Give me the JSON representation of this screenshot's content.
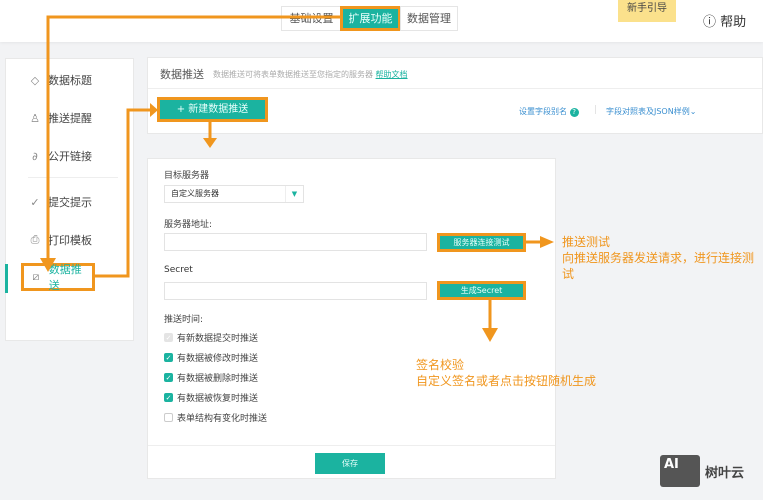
{
  "header": {
    "tabs": [
      {
        "label": "基础设置"
      },
      {
        "label": "扩展功能",
        "active": true
      },
      {
        "label": "数据管理"
      }
    ],
    "guide": "新手引导",
    "help": "帮助"
  },
  "sidebar": {
    "items": [
      {
        "label": "数据标题",
        "icon": "tag-icon"
      },
      {
        "label": "推送提醒",
        "icon": "bell-icon"
      },
      {
        "label": "公开链接",
        "icon": "link-icon"
      },
      {
        "label": "提交提示",
        "icon": "check-circle-icon"
      },
      {
        "label": "打印模板",
        "icon": "printer-icon"
      },
      {
        "label": "数据推送",
        "icon": "chart-icon",
        "active": true
      }
    ]
  },
  "panel": {
    "title": "数据推送",
    "desc": "数据推送可将表单数据推送至您指定的服务器",
    "help_link": "帮助文档",
    "new_button": "+ 新建数据推送",
    "alias_link": "设置字段别名",
    "json_link": "字段对照表及JSON样例"
  },
  "form": {
    "target_label": "目标服务器",
    "target_value": "自定义服务器",
    "address_label": "服务器地址:",
    "address_value": "",
    "test_button": "服务器连接测试",
    "secret_label": "Secret",
    "secret_value": "",
    "secret_button": "生成Secret",
    "time_label": "推送时间:",
    "options": [
      {
        "label": "有新数据提交时推送",
        "checked": true,
        "disabled": true
      },
      {
        "label": "有数据被修改时推送",
        "checked": true
      },
      {
        "label": "有数据被删除时推送",
        "checked": true
      },
      {
        "label": "有数据被恢复时推送",
        "checked": true
      },
      {
        "label": "表单结构有变化时推送",
        "checked": false
      }
    ],
    "save": "保存"
  },
  "annotations": {
    "test_title": "推送测试",
    "test_desc": "向推送服务器发送请求，进行连接测试",
    "sign_title": "签名校验",
    "sign_desc": "自定义签名或者点击按钮随机生成"
  },
  "watermark": "树叶云",
  "colors": {
    "accent": "#1bb3a0",
    "annotation": "#f0961e"
  }
}
